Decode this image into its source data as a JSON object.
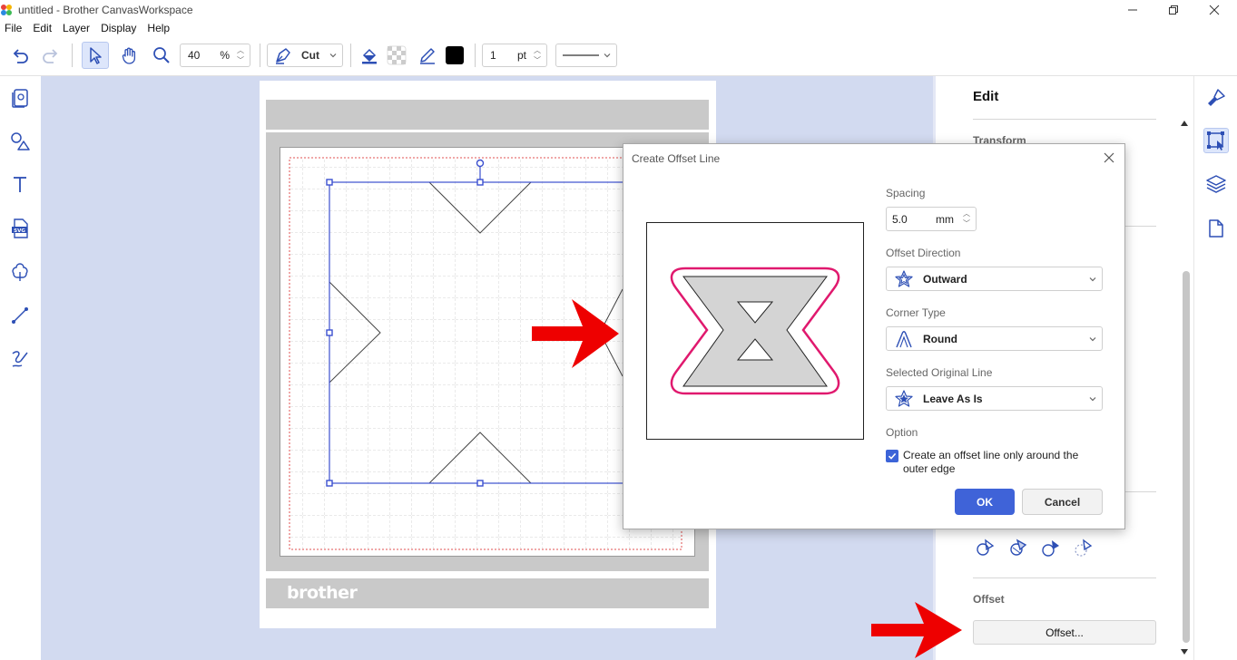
{
  "window": {
    "title": "untitled - Brother CanvasWorkspace"
  },
  "menu": [
    "File",
    "Edit",
    "Layer",
    "Display",
    "Help"
  ],
  "toolbar": {
    "zoom_value": "40",
    "zoom_unit": "%",
    "cut_mode": "Cut",
    "line_width_value": "1",
    "line_width_unit": "pt"
  },
  "mat": {
    "brand": "brother"
  },
  "edit_panel": {
    "title": "Edit",
    "transform_label": "Transform",
    "offset_label": "Offset",
    "offset_button": "Offset..."
  },
  "dialog": {
    "title": "Create Offset Line",
    "spacing_label": "Spacing",
    "spacing_value": "5.0",
    "spacing_unit": "mm",
    "offset_direction_label": "Offset Direction",
    "offset_direction_value": "Outward",
    "corner_type_label": "Corner Type",
    "corner_type_value": "Round",
    "selected_original_label": "Selected Original Line",
    "selected_original_value": "Leave As Is",
    "option_label": "Option",
    "option_checked": true,
    "option_text": "Create an offset line only around the outer edge",
    "ok_button": "OK",
    "cancel_button": "Cancel"
  },
  "colors": {
    "accent": "#3f63d8",
    "canvas_bg": "#d2daf0",
    "offset_line": "#e0196e",
    "annotation_arrow": "#ee0000"
  }
}
